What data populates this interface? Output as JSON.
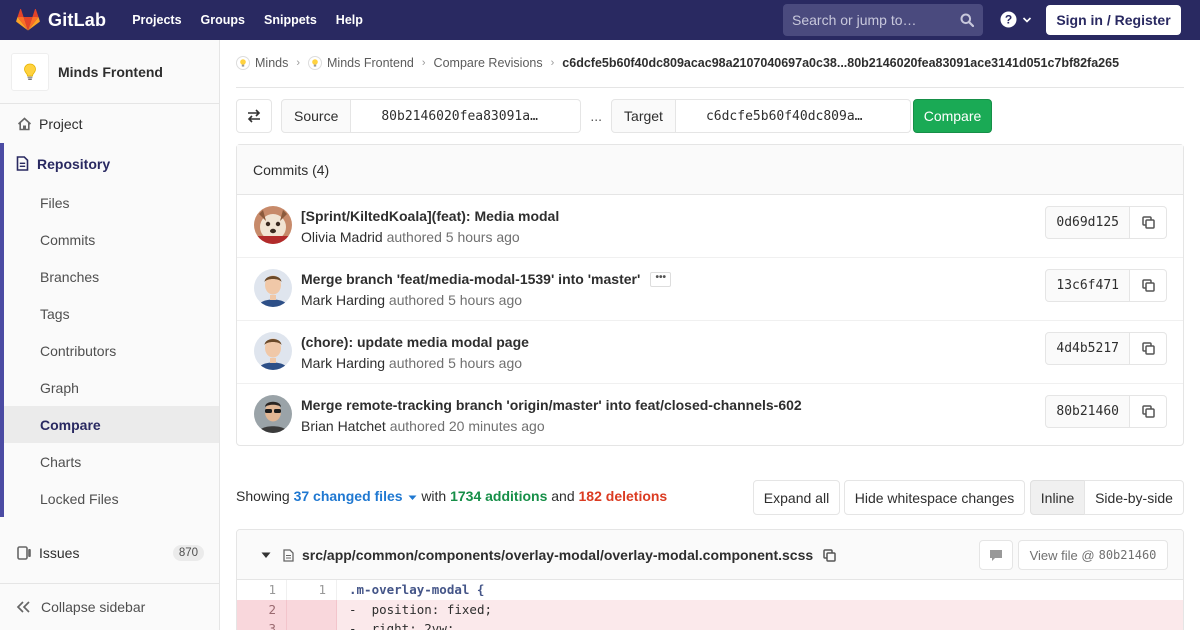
{
  "topnav": {
    "brand": "GitLab",
    "links": [
      "Projects",
      "Groups",
      "Snippets",
      "Help"
    ],
    "search_placeholder": "Search or jump to…",
    "signin": "Sign in / Register"
  },
  "sidebar": {
    "project_name": "Minds Frontend",
    "project_item": "Project",
    "repository": "Repository",
    "repo_items": [
      "Files",
      "Commits",
      "Branches",
      "Tags",
      "Contributors",
      "Graph",
      "Compare",
      "Charts",
      "Locked Files"
    ],
    "active_item": "Compare",
    "issues": "Issues",
    "issues_count": "870",
    "collapse": "Collapse sidebar"
  },
  "breadcrumb": {
    "items": [
      "Minds",
      "Minds Frontend",
      "Compare Revisions"
    ],
    "current": "c6dcfe5b60f40dc809acac98a2107040697a0c38...80b2146020fea83091ace3141d051c7bf82fa265"
  },
  "compare": {
    "source_label": "Source",
    "source_ref": "80b2146020fea83091a…",
    "dots": "...",
    "target_label": "Target",
    "target_ref": "c6dcfe5b60f40dc809a…",
    "button": "Compare"
  },
  "commits": {
    "header": "Commits (4)",
    "authored": "authored",
    "list": [
      {
        "title": "[Sprint/KiltedKoala](feat): Media modal",
        "author": "Olivia Madrid",
        "time": "5 hours ago",
        "sha": "0d69d125"
      },
      {
        "title": "Merge branch 'feat/media-modal-1539' into 'master'",
        "author": "Mark Harding",
        "time": "5 hours ago",
        "sha": "13c6f471"
      },
      {
        "title": "(chore): update media modal page",
        "author": "Mark Harding",
        "time": "5 hours ago",
        "sha": "4d4b5217"
      },
      {
        "title": "Merge remote-tracking branch 'origin/master' into feat/closed-channels-602",
        "author": "Brian Hatchet",
        "time": "20 minutes ago",
        "sha": "80b21460"
      }
    ]
  },
  "diff_stats": {
    "showing": "Showing",
    "changed_files": "37 changed files",
    "with": "with",
    "additions": "1734 additions",
    "and": "and",
    "deletions": "182 deletions"
  },
  "diff_buttons": {
    "expand_all": "Expand all",
    "hide_whitespace": "Hide whitespace changes",
    "inline": "Inline",
    "side_by_side": "Side-by-side"
  },
  "file": {
    "path": "src/app/common/components/overlay-modal/overlay-modal.component.scss",
    "view_file": "View file @",
    "view_sha": "80b21460",
    "lines": [
      {
        "old": "1",
        "new": "1",
        "sign": " ",
        "code": ".m-overlay-modal {"
      },
      {
        "old": "2",
        "new": "",
        "sign": "-",
        "code": "  position: fixed;"
      },
      {
        "old": "3",
        "new": "",
        "sign": "-",
        "code": "  right: 2vw;"
      }
    ]
  }
}
